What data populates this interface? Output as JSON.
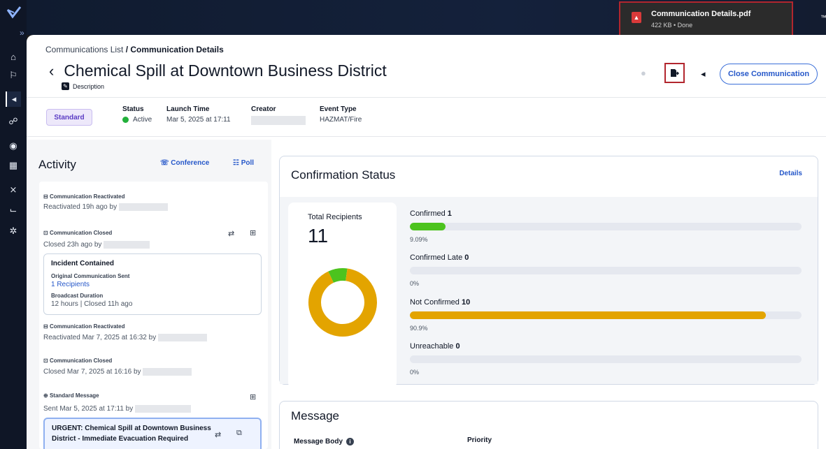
{
  "sidebar": {
    "expand_label": "»",
    "items": [
      {
        "name": "home-icon",
        "glyph": "⌂"
      },
      {
        "name": "map-icon",
        "glyph": "⚐"
      },
      {
        "name": "megaphone-icon",
        "glyph": "◂"
      },
      {
        "name": "people-icon",
        "glyph": "☍"
      },
      {
        "name": "location-icon",
        "glyph": "◉"
      },
      {
        "name": "calendar-icon",
        "glyph": "▦"
      },
      {
        "name": "tools-icon",
        "glyph": "⨯"
      },
      {
        "name": "chart-icon",
        "glyph": "⌙"
      },
      {
        "name": "gear-icon",
        "glyph": "✲"
      }
    ]
  },
  "download": {
    "filename": "Communication Details.pdf",
    "meta": "422 KB • Done"
  },
  "topbar": {
    "tm_text": "™"
  },
  "breadcrumb": {
    "parent": "Communications List",
    "separator": " / ",
    "current": "Communication Details"
  },
  "header": {
    "back": "‹",
    "title": "Chemical Spill at Downtown Business District",
    "description_label": "Description",
    "close_button": "Close Communication"
  },
  "summary": {
    "type_badge": "Standard",
    "status_label": "Status",
    "status_value": "Active",
    "launch_label": "Launch Time",
    "launch_value": "Mar 5, 2025 at 17:11",
    "creator_label": "Creator",
    "event_label": "Event Type",
    "event_value": "HAZMAT/Fire"
  },
  "activity": {
    "title": "Activity",
    "conference_label": "Conference",
    "poll_label": "Poll",
    "entries": [
      {
        "head": "Communication Reactivated",
        "sub": "Reactivated 19h ago by"
      },
      {
        "head": "Communication Closed",
        "sub": "Closed 23h ago by"
      },
      {
        "head": "Communication Reactivated",
        "sub": "Reactivated Mar 7, 2025 at 16:32 by"
      },
      {
        "head": "Communication Closed",
        "sub": "Closed Mar 7, 2025 at 16:16 by"
      },
      {
        "head": "Standard Message",
        "sub": "Sent Mar 5, 2025 at 17:11 by"
      }
    ],
    "card1": {
      "title": "Incident Contained",
      "orig_label": "Original Communication Sent",
      "recipients": "1 Recipients",
      "duration_label": "Broadcast Duration",
      "duration_value": "12 hours | Closed 11h ago"
    },
    "card2": {
      "title_line1": "URGENT: Chemical Spill at Downtown Business",
      "title_line2": "District - Immediate Evacuation Required"
    }
  },
  "confirmation": {
    "title": "Confirmation Status",
    "details_link": "Details",
    "total_label": "Total Recipients",
    "total_value": "11",
    "bars": [
      {
        "label": "Confirmed",
        "count": "1",
        "pct_text": "9.09%",
        "fraction": 0.0909,
        "color": "#4cc31e"
      },
      {
        "label": "Confirmed Late",
        "count": "0",
        "pct_text": "0%",
        "fraction": 0,
        "color": "#4cc31e"
      },
      {
        "label": "Not Confirmed",
        "count": "10",
        "pct_text": "90.9%",
        "fraction": 0.909,
        "color": "#e3a400"
      },
      {
        "label": "Unreachable",
        "count": "0",
        "pct_text": "0%",
        "fraction": 0,
        "color": "#9ca3af"
      }
    ]
  },
  "chart_data": {
    "type": "pie",
    "categories": [
      "Confirmed",
      "Not Confirmed"
    ],
    "values": [
      1,
      10
    ],
    "colors": [
      "#4cc31e",
      "#e3a400"
    ],
    "donut": true
  },
  "message": {
    "title": "Message",
    "body_label": "Message Body",
    "info_glyph": "i",
    "priority_label": "Priority"
  },
  "colors": {
    "accent": "#2557c9",
    "highlight_border": "#b2262e"
  }
}
